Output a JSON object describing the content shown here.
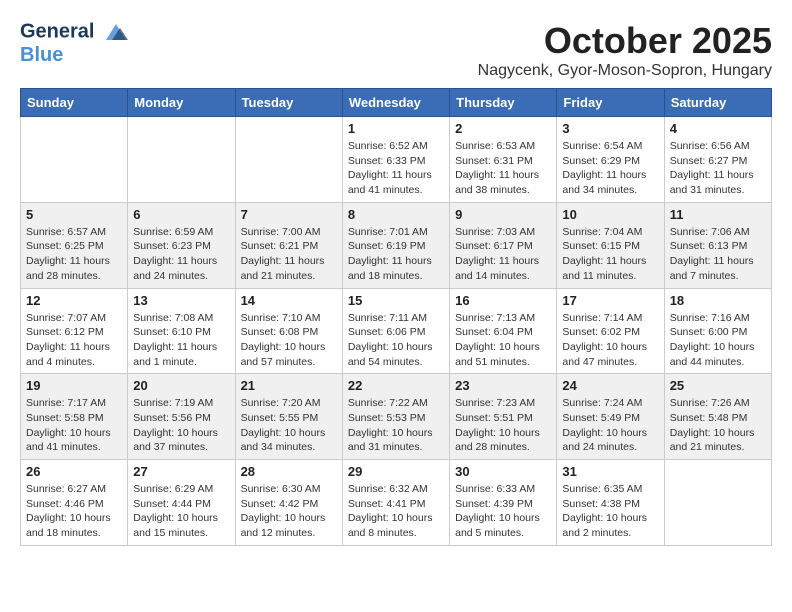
{
  "header": {
    "logo_line1": "General",
    "logo_line2": "Blue",
    "month": "October 2025",
    "location": "Nagycenk, Gyor-Moson-Sopron, Hungary"
  },
  "weekdays": [
    "Sunday",
    "Monday",
    "Tuesday",
    "Wednesday",
    "Thursday",
    "Friday",
    "Saturday"
  ],
  "weeks": [
    [
      {
        "day": "",
        "sunrise": "",
        "sunset": "",
        "daylight": ""
      },
      {
        "day": "",
        "sunrise": "",
        "sunset": "",
        "daylight": ""
      },
      {
        "day": "",
        "sunrise": "",
        "sunset": "",
        "daylight": ""
      },
      {
        "day": "1",
        "sunrise": "Sunrise: 6:52 AM",
        "sunset": "Sunset: 6:33 PM",
        "daylight": "Daylight: 11 hours and 41 minutes."
      },
      {
        "day": "2",
        "sunrise": "Sunrise: 6:53 AM",
        "sunset": "Sunset: 6:31 PM",
        "daylight": "Daylight: 11 hours and 38 minutes."
      },
      {
        "day": "3",
        "sunrise": "Sunrise: 6:54 AM",
        "sunset": "Sunset: 6:29 PM",
        "daylight": "Daylight: 11 hours and 34 minutes."
      },
      {
        "day": "4",
        "sunrise": "Sunrise: 6:56 AM",
        "sunset": "Sunset: 6:27 PM",
        "daylight": "Daylight: 11 hours and 31 minutes."
      }
    ],
    [
      {
        "day": "5",
        "sunrise": "Sunrise: 6:57 AM",
        "sunset": "Sunset: 6:25 PM",
        "daylight": "Daylight: 11 hours and 28 minutes."
      },
      {
        "day": "6",
        "sunrise": "Sunrise: 6:59 AM",
        "sunset": "Sunset: 6:23 PM",
        "daylight": "Daylight: 11 hours and 24 minutes."
      },
      {
        "day": "7",
        "sunrise": "Sunrise: 7:00 AM",
        "sunset": "Sunset: 6:21 PM",
        "daylight": "Daylight: 11 hours and 21 minutes."
      },
      {
        "day": "8",
        "sunrise": "Sunrise: 7:01 AM",
        "sunset": "Sunset: 6:19 PM",
        "daylight": "Daylight: 11 hours and 18 minutes."
      },
      {
        "day": "9",
        "sunrise": "Sunrise: 7:03 AM",
        "sunset": "Sunset: 6:17 PM",
        "daylight": "Daylight: 11 hours and 14 minutes."
      },
      {
        "day": "10",
        "sunrise": "Sunrise: 7:04 AM",
        "sunset": "Sunset: 6:15 PM",
        "daylight": "Daylight: 11 hours and 11 minutes."
      },
      {
        "day": "11",
        "sunrise": "Sunrise: 7:06 AM",
        "sunset": "Sunset: 6:13 PM",
        "daylight": "Daylight: 11 hours and 7 minutes."
      }
    ],
    [
      {
        "day": "12",
        "sunrise": "Sunrise: 7:07 AM",
        "sunset": "Sunset: 6:12 PM",
        "daylight": "Daylight: 11 hours and 4 minutes."
      },
      {
        "day": "13",
        "sunrise": "Sunrise: 7:08 AM",
        "sunset": "Sunset: 6:10 PM",
        "daylight": "Daylight: 11 hours and 1 minute."
      },
      {
        "day": "14",
        "sunrise": "Sunrise: 7:10 AM",
        "sunset": "Sunset: 6:08 PM",
        "daylight": "Daylight: 10 hours and 57 minutes."
      },
      {
        "day": "15",
        "sunrise": "Sunrise: 7:11 AM",
        "sunset": "Sunset: 6:06 PM",
        "daylight": "Daylight: 10 hours and 54 minutes."
      },
      {
        "day": "16",
        "sunrise": "Sunrise: 7:13 AM",
        "sunset": "Sunset: 6:04 PM",
        "daylight": "Daylight: 10 hours and 51 minutes."
      },
      {
        "day": "17",
        "sunrise": "Sunrise: 7:14 AM",
        "sunset": "Sunset: 6:02 PM",
        "daylight": "Daylight: 10 hours and 47 minutes."
      },
      {
        "day": "18",
        "sunrise": "Sunrise: 7:16 AM",
        "sunset": "Sunset: 6:00 PM",
        "daylight": "Daylight: 10 hours and 44 minutes."
      }
    ],
    [
      {
        "day": "19",
        "sunrise": "Sunrise: 7:17 AM",
        "sunset": "Sunset: 5:58 PM",
        "daylight": "Daylight: 10 hours and 41 minutes."
      },
      {
        "day": "20",
        "sunrise": "Sunrise: 7:19 AM",
        "sunset": "Sunset: 5:56 PM",
        "daylight": "Daylight: 10 hours and 37 minutes."
      },
      {
        "day": "21",
        "sunrise": "Sunrise: 7:20 AM",
        "sunset": "Sunset: 5:55 PM",
        "daylight": "Daylight: 10 hours and 34 minutes."
      },
      {
        "day": "22",
        "sunrise": "Sunrise: 7:22 AM",
        "sunset": "Sunset: 5:53 PM",
        "daylight": "Daylight: 10 hours and 31 minutes."
      },
      {
        "day": "23",
        "sunrise": "Sunrise: 7:23 AM",
        "sunset": "Sunset: 5:51 PM",
        "daylight": "Daylight: 10 hours and 28 minutes."
      },
      {
        "day": "24",
        "sunrise": "Sunrise: 7:24 AM",
        "sunset": "Sunset: 5:49 PM",
        "daylight": "Daylight: 10 hours and 24 minutes."
      },
      {
        "day": "25",
        "sunrise": "Sunrise: 7:26 AM",
        "sunset": "Sunset: 5:48 PM",
        "daylight": "Daylight: 10 hours and 21 minutes."
      }
    ],
    [
      {
        "day": "26",
        "sunrise": "Sunrise: 6:27 AM",
        "sunset": "Sunset: 4:46 PM",
        "daylight": "Daylight: 10 hours and 18 minutes."
      },
      {
        "day": "27",
        "sunrise": "Sunrise: 6:29 AM",
        "sunset": "Sunset: 4:44 PM",
        "daylight": "Daylight: 10 hours and 15 minutes."
      },
      {
        "day": "28",
        "sunrise": "Sunrise: 6:30 AM",
        "sunset": "Sunset: 4:42 PM",
        "daylight": "Daylight: 10 hours and 12 minutes."
      },
      {
        "day": "29",
        "sunrise": "Sunrise: 6:32 AM",
        "sunset": "Sunset: 4:41 PM",
        "daylight": "Daylight: 10 hours and 8 minutes."
      },
      {
        "day": "30",
        "sunrise": "Sunrise: 6:33 AM",
        "sunset": "Sunset: 4:39 PM",
        "daylight": "Daylight: 10 hours and 5 minutes."
      },
      {
        "day": "31",
        "sunrise": "Sunrise: 6:35 AM",
        "sunset": "Sunset: 4:38 PM",
        "daylight": "Daylight: 10 hours and 2 minutes."
      },
      {
        "day": "",
        "sunrise": "",
        "sunset": "",
        "daylight": ""
      }
    ]
  ]
}
